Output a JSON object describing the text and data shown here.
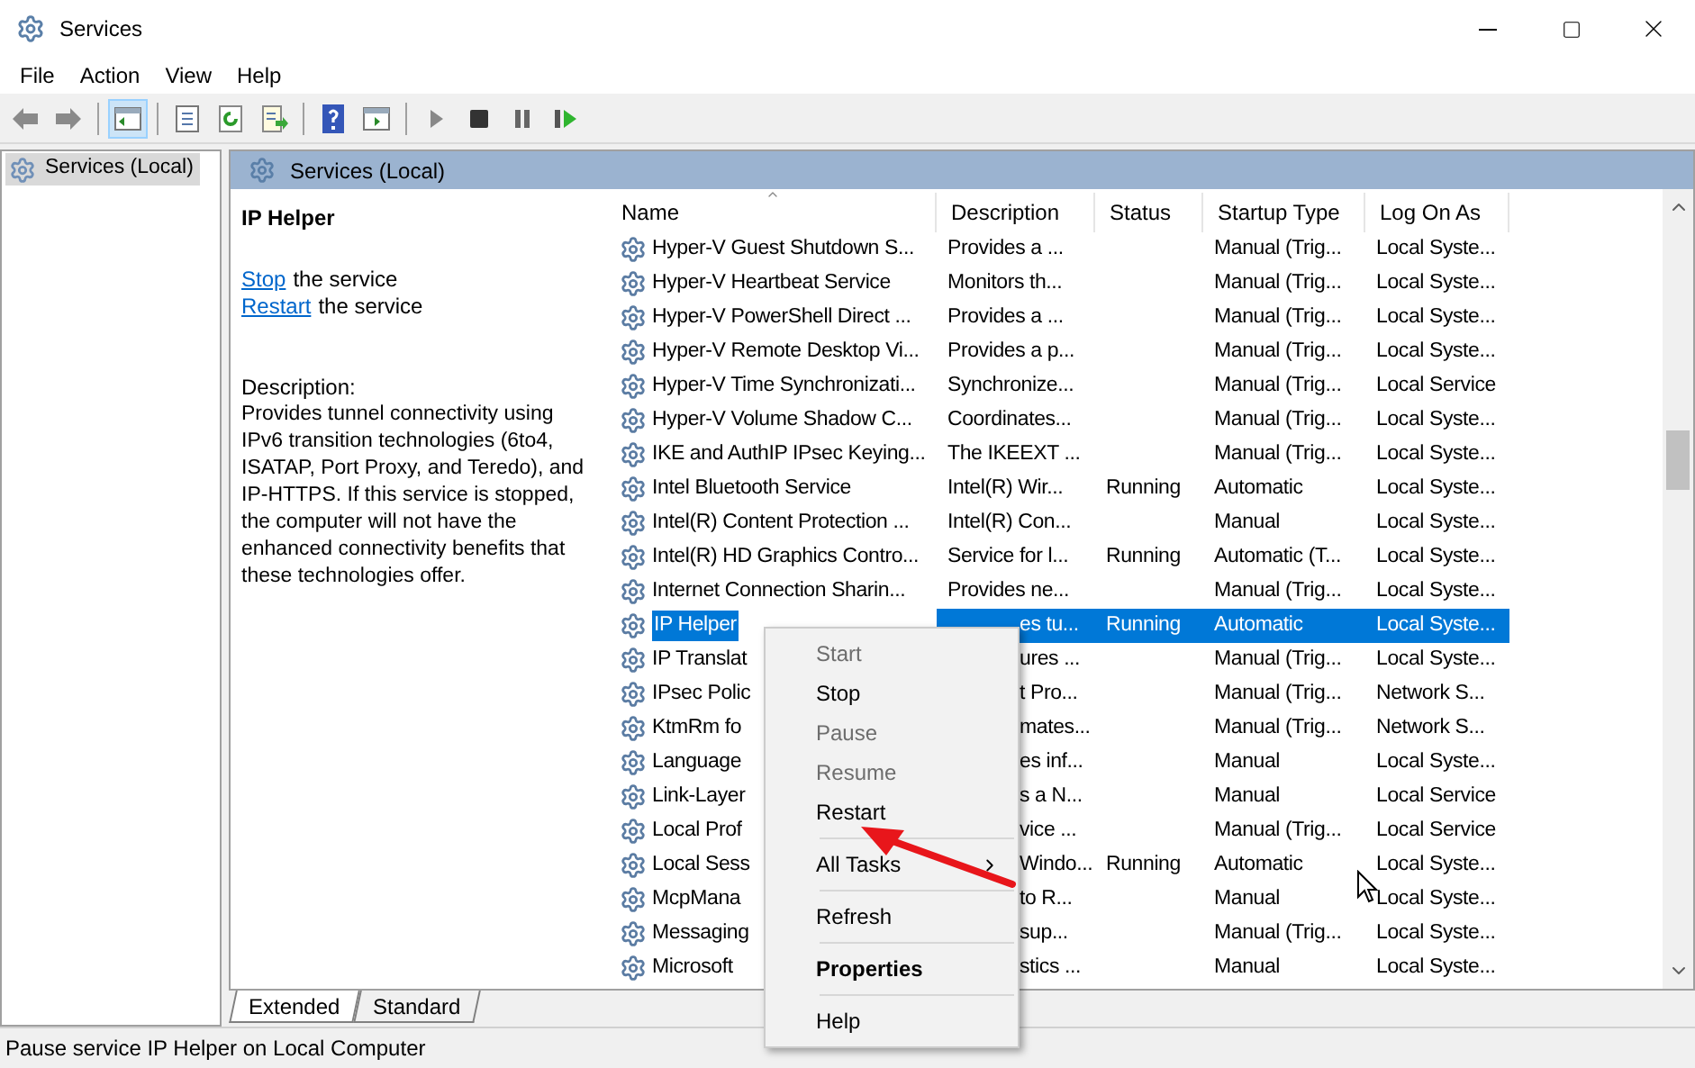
{
  "window": {
    "title": "Services"
  },
  "menu_bar": [
    "File",
    "Action",
    "View",
    "Help"
  ],
  "tree": [
    {
      "label": "Services (Local)",
      "selected": true
    }
  ],
  "header": {
    "title": "Services (Local)"
  },
  "detail": {
    "title": "IP Helper",
    "actions": [
      {
        "link": "Stop",
        "text": "the service"
      },
      {
        "link": "Restart",
        "text": "the service"
      }
    ],
    "description_label": "Description:",
    "description": "Provides tunnel connectivity using IPv6 transition technologies (6to4, ISATAP, Port Proxy, and Teredo), and IP-HTTPS. If this service is stopped, the computer will not have the enhanced connectivity benefits that these technologies offer."
  },
  "table": {
    "columns": [
      {
        "label": "Name",
        "sorted": true
      },
      {
        "label": "Description",
        "sorted": false
      },
      {
        "label": "Status",
        "sorted": false
      },
      {
        "label": "Startup Type",
        "sorted": false
      },
      {
        "label": "Log On As",
        "sorted": false
      }
    ],
    "rows": [
      {
        "name": "Hyper-V Guest Shutdown S...",
        "description": "Provides a ...",
        "status": "",
        "startup": "Manual (Trig...",
        "logon": "Local Syste...",
        "selected": false
      },
      {
        "name": "Hyper-V Heartbeat Service",
        "description": "Monitors th...",
        "status": "",
        "startup": "Manual (Trig...",
        "logon": "Local Syste...",
        "selected": false
      },
      {
        "name": "Hyper-V PowerShell Direct ...",
        "description": "Provides a ...",
        "status": "",
        "startup": "Manual (Trig...",
        "logon": "Local Syste...",
        "selected": false
      },
      {
        "name": "Hyper-V Remote Desktop Vi...",
        "description": "Provides a p...",
        "status": "",
        "startup": "Manual (Trig...",
        "logon": "Local Syste...",
        "selected": false
      },
      {
        "name": "Hyper-V Time Synchronizati...",
        "description": "Synchronize...",
        "status": "",
        "startup": "Manual (Trig...",
        "logon": "Local Service",
        "selected": false
      },
      {
        "name": "Hyper-V Volume Shadow C...",
        "description": "Coordinates...",
        "status": "",
        "startup": "Manual (Trig...",
        "logon": "Local Syste...",
        "selected": false
      },
      {
        "name": "IKE and AuthIP IPsec Keying...",
        "description": "The IKEEXT ...",
        "status": "",
        "startup": "Manual (Trig...",
        "logon": "Local Syste...",
        "selected": false
      },
      {
        "name": "Intel Bluetooth Service",
        "description": "Intel(R) Wir...",
        "status": "Running",
        "startup": "Automatic",
        "logon": "Local Syste...",
        "selected": false
      },
      {
        "name": "Intel(R) Content Protection ...",
        "description": "Intel(R) Con...",
        "status": "",
        "startup": "Manual",
        "logon": "Local Syste...",
        "selected": false
      },
      {
        "name": "Intel(R) HD Graphics Contro...",
        "description": "Service for l...",
        "status": "Running",
        "startup": "Automatic (T...",
        "logon": "Local Syste...",
        "selected": false
      },
      {
        "name": "Internet Connection Sharin...",
        "description": "Provides ne...",
        "status": "",
        "startup": "Manual (Trig...",
        "logon": "Local Syste...",
        "selected": false
      },
      {
        "name": "IP Helper",
        "description": "es tu...",
        "status": "Running",
        "startup": "Automatic",
        "logon": "Local Syste...",
        "selected": true
      },
      {
        "name": "IP Translat",
        "description": "ures ...",
        "status": "",
        "startup": "Manual (Trig...",
        "logon": "Local Syste...",
        "selected": false
      },
      {
        "name": "IPsec Polic",
        "description": "t Pro...",
        "status": "",
        "startup": "Manual (Trig...",
        "logon": "Network S...",
        "selected": false
      },
      {
        "name": "KtmRm fo",
        "description": "mates...",
        "status": "",
        "startup": "Manual (Trig...",
        "logon": "Network S...",
        "selected": false
      },
      {
        "name": "Language",
        "description": "es inf...",
        "status": "",
        "startup": "Manual",
        "logon": "Local Syste...",
        "selected": false
      },
      {
        "name": "Link-Layer",
        "description": "s a N...",
        "status": "",
        "startup": "Manual",
        "logon": "Local Service",
        "selected": false
      },
      {
        "name": "Local Prof",
        "description": "vice ...",
        "status": "",
        "startup": "Manual (Trig...",
        "logon": "Local Service",
        "selected": false
      },
      {
        "name": "Local Sess",
        "description": "Windo...",
        "status": "Running",
        "startup": "Automatic",
        "logon": "Local Syste...",
        "selected": false
      },
      {
        "name": "McpMana",
        "description": "to R...",
        "status": "",
        "startup": "Manual",
        "logon": "Local Syste...",
        "selected": false
      },
      {
        "name": "Messaging",
        "description": "sup...",
        "status": "",
        "startup": "Manual (Trig...",
        "logon": "Local Syste...",
        "selected": false
      },
      {
        "name": "Microsoft",
        "description": "stics ...",
        "status": "",
        "startup": "Manual",
        "logon": "Local Syste...",
        "selected": false
      }
    ]
  },
  "view_tabs": [
    {
      "label": "Extended",
      "selected": true
    },
    {
      "label": "Standard",
      "selected": false
    }
  ],
  "context_menu": [
    {
      "kind": "item",
      "label": "Start",
      "disabled": true,
      "default": false
    },
    {
      "kind": "item",
      "label": "Stop",
      "disabled": false,
      "default": false
    },
    {
      "kind": "item",
      "label": "Pause",
      "disabled": true,
      "default": false
    },
    {
      "kind": "item",
      "label": "Resume",
      "disabled": true,
      "default": false
    },
    {
      "kind": "item",
      "label": "Restart",
      "disabled": false,
      "default": false
    },
    {
      "kind": "separator"
    },
    {
      "kind": "submenu",
      "label": "All Tasks",
      "disabled": false,
      "default": false
    },
    {
      "kind": "separator"
    },
    {
      "kind": "item",
      "label": "Refresh",
      "disabled": false,
      "default": false
    },
    {
      "kind": "separator"
    },
    {
      "kind": "item",
      "label": "Properties",
      "disabled": false,
      "default": true
    },
    {
      "kind": "separator"
    },
    {
      "kind": "item",
      "label": "Help",
      "disabled": false,
      "default": false
    }
  ],
  "status_bar": "Pause service IP Helper on Local Computer"
}
